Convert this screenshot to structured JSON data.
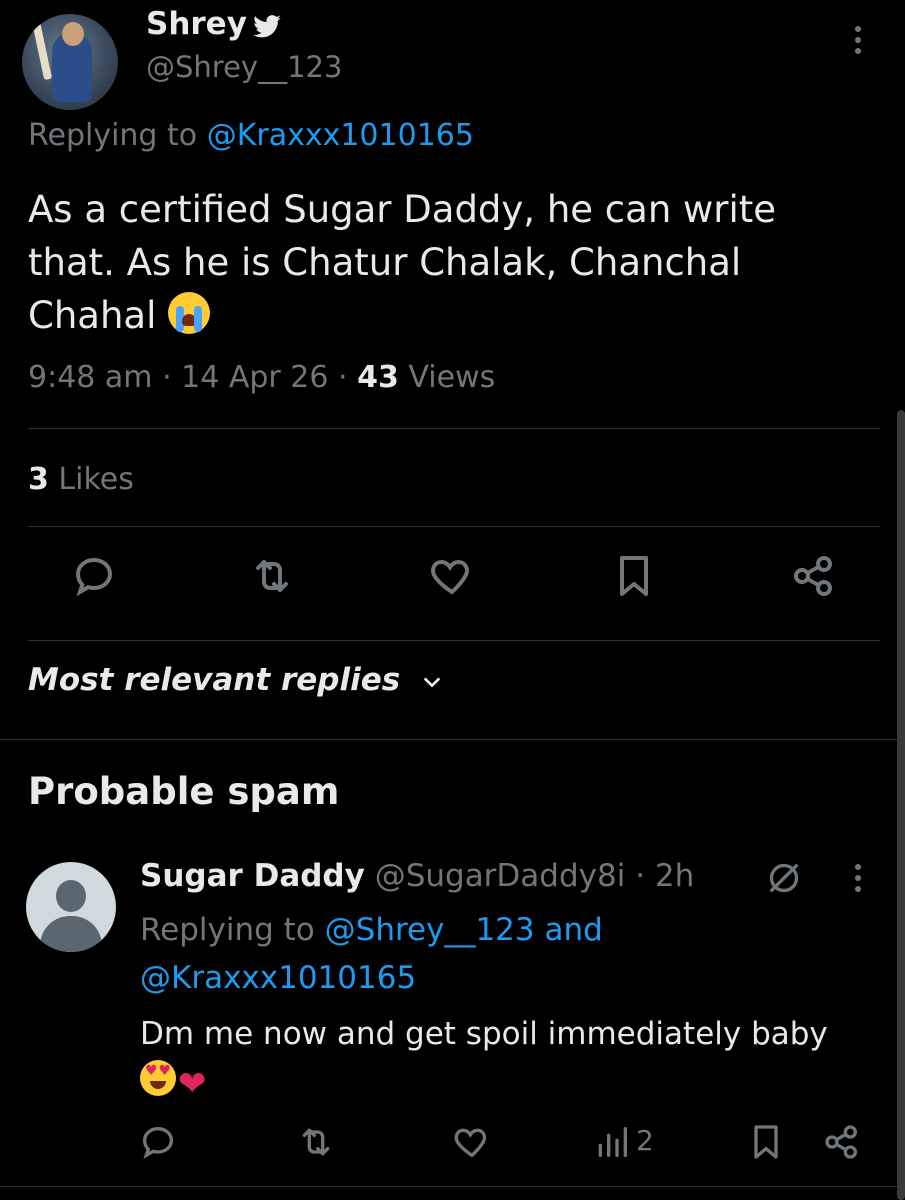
{
  "tweet": {
    "author_name": "Shrey",
    "author_handle": "@Shrey__123",
    "replying_prefix": "Replying to",
    "replying_to": "@Kraxxx1010165",
    "text": "As a certified Sugar Daddy, he can write that. As he is Chatur Chalak, Chanchal Chahal",
    "time": "9:48 am",
    "date": "14 Apr 26",
    "sep": "·",
    "views_count": "43",
    "views_label": "Views",
    "likes_count": "3",
    "likes_label": "Likes"
  },
  "sort": {
    "label": "Most relevant replies"
  },
  "section": {
    "title": "Probable spam"
  },
  "reply": {
    "author_name": "Sugar Daddy",
    "author_handle": "@SugarDaddy8i",
    "sep": "·",
    "age": "2h",
    "replying_prefix": "Replying to",
    "replying_to_1": "@Shrey__123",
    "and": "and",
    "replying_to_2": "@Kraxxx1010165",
    "text": "Dm me now and get spoil immediately baby",
    "views_count": "2"
  },
  "icons": {
    "verified": "bird-icon",
    "actions": [
      "reply-icon",
      "retweet-icon",
      "like-icon",
      "bookmark-icon",
      "share-icon"
    ],
    "reply_actions": [
      "reply-icon",
      "retweet-icon",
      "like-icon",
      "views-icon",
      "bookmark-icon",
      "share-icon"
    ]
  },
  "colors": {
    "background": "#000000",
    "text": "#e7e9ea",
    "muted": "#71767b",
    "link": "#1d9bf0",
    "heart": "#e0245e"
  }
}
